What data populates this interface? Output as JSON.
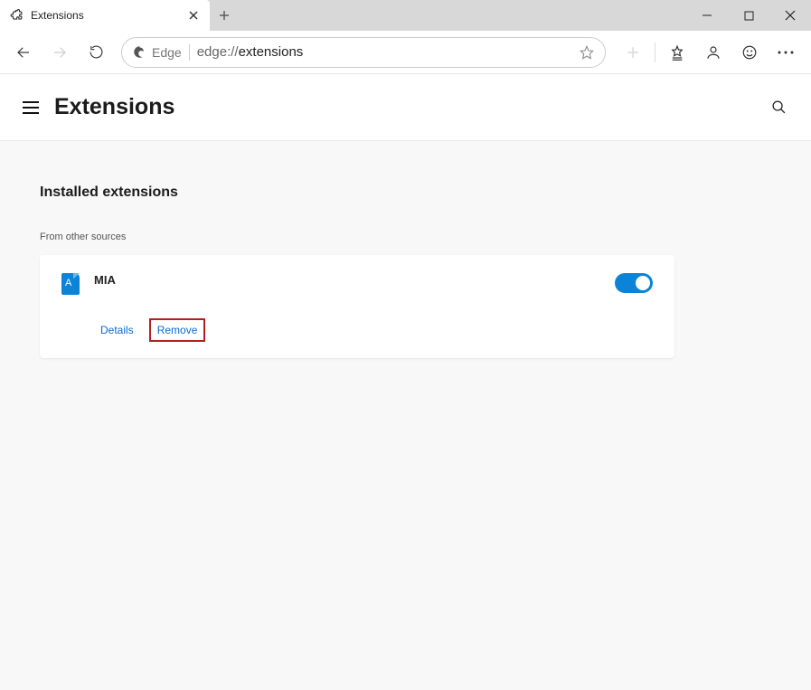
{
  "tab": {
    "title": "Extensions"
  },
  "addressbar": {
    "identity": "Edge",
    "url_proto": "edge://",
    "url_path": "extensions"
  },
  "page": {
    "title": "Extensions",
    "section_title": "Installed extensions",
    "subhead": "From other sources"
  },
  "extension": {
    "name": "MIA",
    "icon_letter": "A",
    "details_label": "Details",
    "remove_label": "Remove",
    "enabled": true
  }
}
